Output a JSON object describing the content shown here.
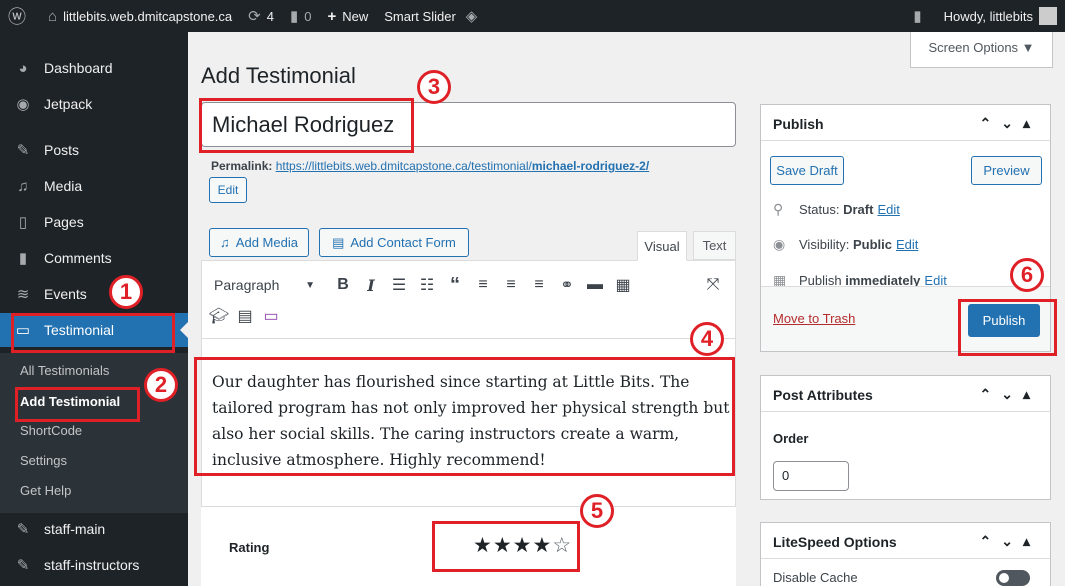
{
  "adminbar": {
    "wp_logo_icon": "wordpress-icon",
    "site_name": "littlebits.web.dmitcapstone.ca",
    "updates_count": "4",
    "comments_count": "0",
    "new_label": "New",
    "smart_slider_label": "Smart Slider",
    "howdy": "Howdy, littlebits"
  },
  "sidebar": {
    "items": [
      {
        "label": "Dashboard",
        "icon": "dashboard-icon"
      },
      {
        "label": "Jetpack",
        "icon": "jetpack-icon"
      },
      {
        "label": "Posts",
        "icon": "pin-icon"
      },
      {
        "label": "Media",
        "icon": "media-icon"
      },
      {
        "label": "Pages",
        "icon": "pages-icon"
      },
      {
        "label": "Comments",
        "icon": "comment-icon"
      },
      {
        "label": "Events",
        "icon": "events-icon"
      },
      {
        "label": "Testimonial",
        "icon": "testimonial-icon"
      },
      {
        "label": "staff-main",
        "icon": "pin-icon"
      },
      {
        "label": "staff-instructors",
        "icon": "pin-icon"
      }
    ],
    "submenu": [
      "All Testimonials",
      "Add Testimonial",
      "ShortCode",
      "Settings",
      "Get Help"
    ]
  },
  "screen_options": "Screen Options ▼",
  "page_title": "Add Testimonial",
  "post_title": "Michael Rodriguez",
  "permalink": {
    "label": "Permalink:",
    "url_base": "https://littlebits.web.dmitcapstone.ca/testimonial/",
    "slug": "michael-rodriguez-2/",
    "edit": "Edit"
  },
  "editor": {
    "add_media": "Add Media",
    "add_contact_form": "Add Contact Form",
    "tab_visual": "Visual",
    "tab_text": "Text",
    "format_select": "Paragraph",
    "content": "Our daughter has flourished since starting at Little Bits. The tailored program has not only improved her physical strength but also her social skills. The caring instructors create a warm, inclusive atmosphere. Highly recommend!"
  },
  "rating": {
    "label": "Rating",
    "value": 4,
    "max": 5,
    "filled": "★★★★",
    "empty": "☆"
  },
  "publish_box": {
    "title": "Publish",
    "save_draft": "Save Draft",
    "preview": "Preview",
    "status_label": "Status:",
    "status_value": "Draft",
    "visibility_label": "Visibility:",
    "visibility_value": "Public",
    "publish_label": "Publish",
    "publish_value": "immediately",
    "edit": "Edit",
    "move_to_trash": "Move to Trash",
    "publish_button": "Publish"
  },
  "post_attributes": {
    "title": "Post Attributes",
    "order_label": "Order",
    "order_value": "0"
  },
  "litespeed": {
    "title": "LiteSpeed Options",
    "disable_cache": "Disable Cache"
  },
  "annotations": [
    "1",
    "2",
    "3",
    "4",
    "5",
    "6"
  ],
  "colors": {
    "admin_dark": "#1d2327",
    "accent_blue": "#2271b1",
    "highlight_red": "#e02027"
  }
}
